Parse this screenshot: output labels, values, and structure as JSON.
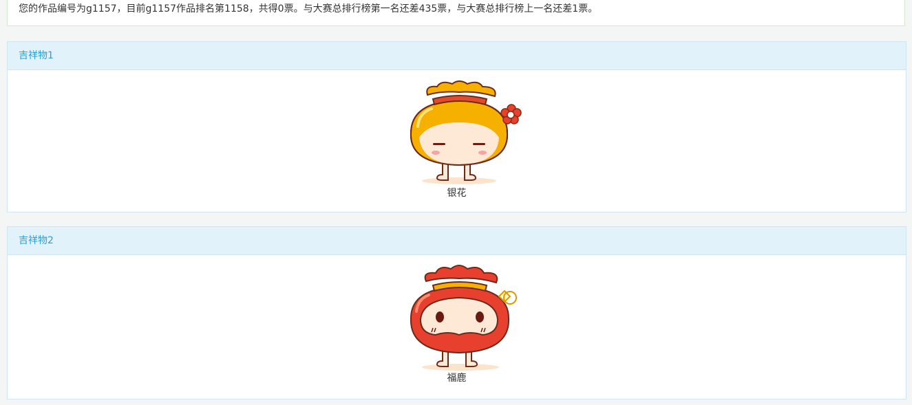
{
  "notice": {
    "text": "您的作品编号为g1157，目前g1157作品排名第1158，共得0票。与大赛总排行榜第一名还差435票，与大赛总排行榜上一名还差1票。"
  },
  "mascots": [
    {
      "heading": "吉祥物1",
      "name": "银花",
      "icon": "yellow-lucky-bag-mascot",
      "color": "#f6b100"
    },
    {
      "heading": "吉祥物2",
      "name": "福鹿",
      "icon": "red-lucky-bag-mascot",
      "color": "#e8402f"
    }
  ],
  "colors": {
    "heading_text": "#2a9fd6",
    "heading_bg": "#e1f2fb",
    "page_bg": "#f4f5f5"
  }
}
